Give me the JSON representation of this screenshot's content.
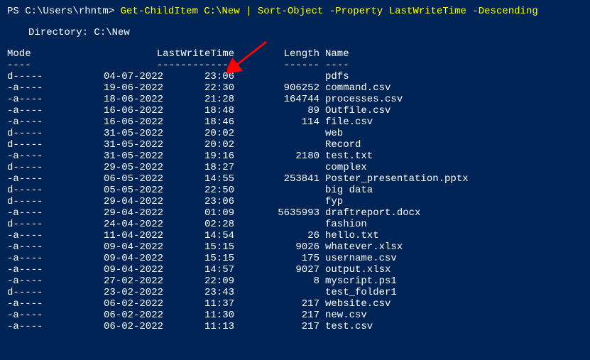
{
  "prompt": {
    "prefix": "PS ",
    "path": "C:\\Users\\rhntm",
    "gt": ">",
    "command": " Get-ChildItem C:\\New | Sort-Object -Property LastWriteTime -Descending"
  },
  "directory": {
    "label": "Directory: ",
    "path": "C:\\New"
  },
  "headers": {
    "mode": "Mode",
    "lastwrite": "LastWriteTime",
    "length": "Length",
    "name": "Name"
  },
  "dividers": {
    "mode": "----",
    "lastwrite": "-------------",
    "length": "------",
    "name": "----"
  },
  "rows": [
    {
      "mode": "d-----",
      "date": "04-07-2022",
      "time": "23:06",
      "length": "",
      "name": "pdfs"
    },
    {
      "mode": "-a----",
      "date": "19-06-2022",
      "time": "22:30",
      "length": "906252",
      "name": "command.csv"
    },
    {
      "mode": "-a----",
      "date": "18-06-2022",
      "time": "21:28",
      "length": "164744",
      "name": "processes.csv"
    },
    {
      "mode": "-a----",
      "date": "16-06-2022",
      "time": "18:48",
      "length": "89",
      "name": "Outfile.csv"
    },
    {
      "mode": "-a----",
      "date": "16-06-2022",
      "time": "18:46",
      "length": "114",
      "name": "file.csv"
    },
    {
      "mode": "d-----",
      "date": "31-05-2022",
      "time": "20:02",
      "length": "",
      "name": "web"
    },
    {
      "mode": "d-----",
      "date": "31-05-2022",
      "time": "20:02",
      "length": "",
      "name": "Record"
    },
    {
      "mode": "-a----",
      "date": "31-05-2022",
      "time": "19:16",
      "length": "2180",
      "name": "test.txt"
    },
    {
      "mode": "d-----",
      "date": "29-05-2022",
      "time": "18:27",
      "length": "",
      "name": "complex"
    },
    {
      "mode": "-a----",
      "date": "06-05-2022",
      "time": "14:55",
      "length": "253841",
      "name": "Poster_presentation.pptx"
    },
    {
      "mode": "d-----",
      "date": "05-05-2022",
      "time": "22:50",
      "length": "",
      "name": "big data"
    },
    {
      "mode": "d-----",
      "date": "29-04-2022",
      "time": "23:06",
      "length": "",
      "name": "fyp"
    },
    {
      "mode": "-a----",
      "date": "29-04-2022",
      "time": "01:09",
      "length": "5635993",
      "name": "draftreport.docx"
    },
    {
      "mode": "d-----",
      "date": "24-04-2022",
      "time": "02:28",
      "length": "",
      "name": "fashion"
    },
    {
      "mode": "-a----",
      "date": "11-04-2022",
      "time": "14:54",
      "length": "26",
      "name": "hello.txt"
    },
    {
      "mode": "-a----",
      "date": "09-04-2022",
      "time": "15:15",
      "length": "9026",
      "name": "whatever.xlsx"
    },
    {
      "mode": "-a----",
      "date": "09-04-2022",
      "time": "15:15",
      "length": "175",
      "name": "username.csv"
    },
    {
      "mode": "-a----",
      "date": "09-04-2022",
      "time": "14:57",
      "length": "9027",
      "name": "output.xlsx"
    },
    {
      "mode": "-a----",
      "date": "27-02-2022",
      "time": "22:09",
      "length": "8",
      "name": "myscript.ps1"
    },
    {
      "mode": "d-----",
      "date": "23-02-2022",
      "time": "23:43",
      "length": "",
      "name": "test_folder1"
    },
    {
      "mode": "-a----",
      "date": "06-02-2022",
      "time": "11:37",
      "length": "217",
      "name": "website.csv"
    },
    {
      "mode": "-a----",
      "date": "06-02-2022",
      "time": "11:30",
      "length": "217",
      "name": "new.csv"
    },
    {
      "mode": "-a----",
      "date": "06-02-2022",
      "time": "11:13",
      "length": "217",
      "name": "test.csv"
    }
  ]
}
